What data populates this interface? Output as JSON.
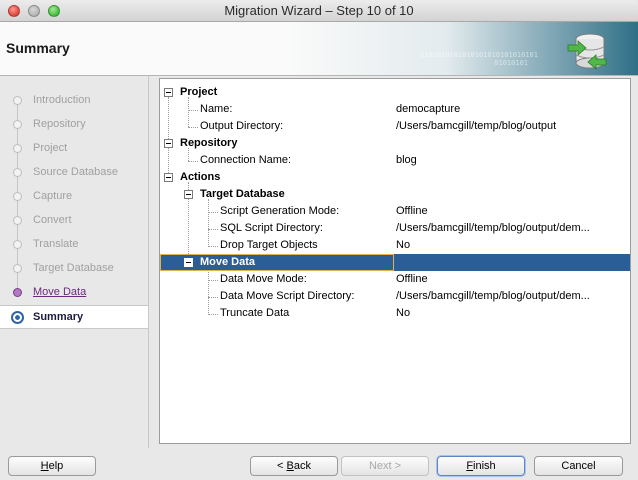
{
  "window": {
    "title": "Migration Wizard – Step 10 of 10"
  },
  "header": {
    "title": "Summary",
    "binary_line1": "0101010101010101010101010101",
    "binary_line2": "01010101"
  },
  "nav": {
    "items": [
      {
        "label": "Introduction",
        "state": "done"
      },
      {
        "label": "Repository",
        "state": "done"
      },
      {
        "label": "Project",
        "state": "done"
      },
      {
        "label": "Source Database",
        "state": "done"
      },
      {
        "label": "Capture",
        "state": "done"
      },
      {
        "label": "Convert",
        "state": "done"
      },
      {
        "label": "Translate",
        "state": "done"
      },
      {
        "label": "Target Database",
        "state": "done"
      },
      {
        "label": "Move Data",
        "state": "visited"
      },
      {
        "label": "Summary",
        "state": "current"
      }
    ]
  },
  "tree": {
    "project": {
      "label": "Project",
      "name_key": "Name:",
      "name_value": "democapture",
      "output_key": "Output Directory:",
      "output_value": "/Users/bamcgill/temp/blog/output"
    },
    "repository": {
      "label": "Repository",
      "conn_key": "Connection Name:",
      "conn_value": "blog"
    },
    "actions": {
      "label": "Actions",
      "target_db": {
        "label": "Target Database",
        "gen_mode_key": "Script Generation Mode:",
        "gen_mode_value": "Offline",
        "sql_dir_key": "SQL Script Directory:",
        "sql_dir_value": "/Users/bamcgill/temp/blog/output/dem...",
        "drop_key": "Drop Target Objects",
        "drop_value": "No"
      },
      "move_data": {
        "label": "Move Data",
        "mode_key": "Data Move Mode:",
        "mode_value": "Offline",
        "script_dir_key": "Data Move Script Directory:",
        "script_dir_value": "/Users/bamcgill/temp/blog/output/dem...",
        "truncate_key": "Truncate Data",
        "truncate_value": "No"
      }
    }
  },
  "buttons": {
    "help_mnemonic": "H",
    "help_rest": "elp",
    "back_prefix": "< ",
    "back_mnemonic": "B",
    "back_rest": "ack",
    "next_label": "Next >",
    "finish_mnemonic": "F",
    "finish_rest": "inish",
    "cancel_label": "Cancel"
  },
  "colors": {
    "selection": "#2b5d96",
    "accent": "#7e3a8e",
    "current": "#2e63a8"
  }
}
